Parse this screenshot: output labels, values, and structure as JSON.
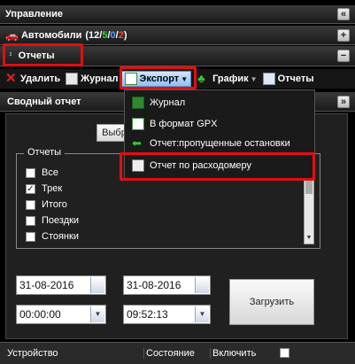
{
  "header": {
    "title": "Управление"
  },
  "cars": {
    "label": "Автомобили",
    "open": "(12/",
    "n_green": "5",
    "sep1": "/",
    "n_blue": "0",
    "sep2": "/",
    "n_red": "2",
    "close": ")"
  },
  "reports_section": {
    "label": "Отчеты"
  },
  "toolbar": {
    "delete": "Удалить",
    "journal": "Журнал",
    "export": "Экспорт",
    "chart": "График",
    "reports": "Отчеты"
  },
  "export_menu": {
    "items": [
      "Журнал",
      "В формат GPX",
      "Отчет:пропущенные остановки",
      "Отчет по расходомеру"
    ]
  },
  "summary": {
    "title": "Сводный отчет",
    "select_btn": "Выбр"
  },
  "reports_group": {
    "legend": "Отчеты",
    "items": [
      {
        "label": "Все",
        "checked": false
      },
      {
        "label": "Трек",
        "checked": true
      },
      {
        "label": "Итого",
        "checked": false
      },
      {
        "label": "Поездки",
        "checked": false
      },
      {
        "label": "Стоянки",
        "checked": false
      }
    ]
  },
  "dates": {
    "from_date": "31-08-2016",
    "to_date": "31-08-2016",
    "from_time": "00:00:00",
    "to_time": "09:52:13"
  },
  "load_btn": "Загрузить",
  "table": {
    "columns": [
      "Устройство",
      "Состояние",
      "Включить"
    ]
  },
  "colors": {
    "highlight": "#e01010",
    "green": "#44cc44",
    "blue": "#5599ff",
    "red": "#ff4444"
  }
}
